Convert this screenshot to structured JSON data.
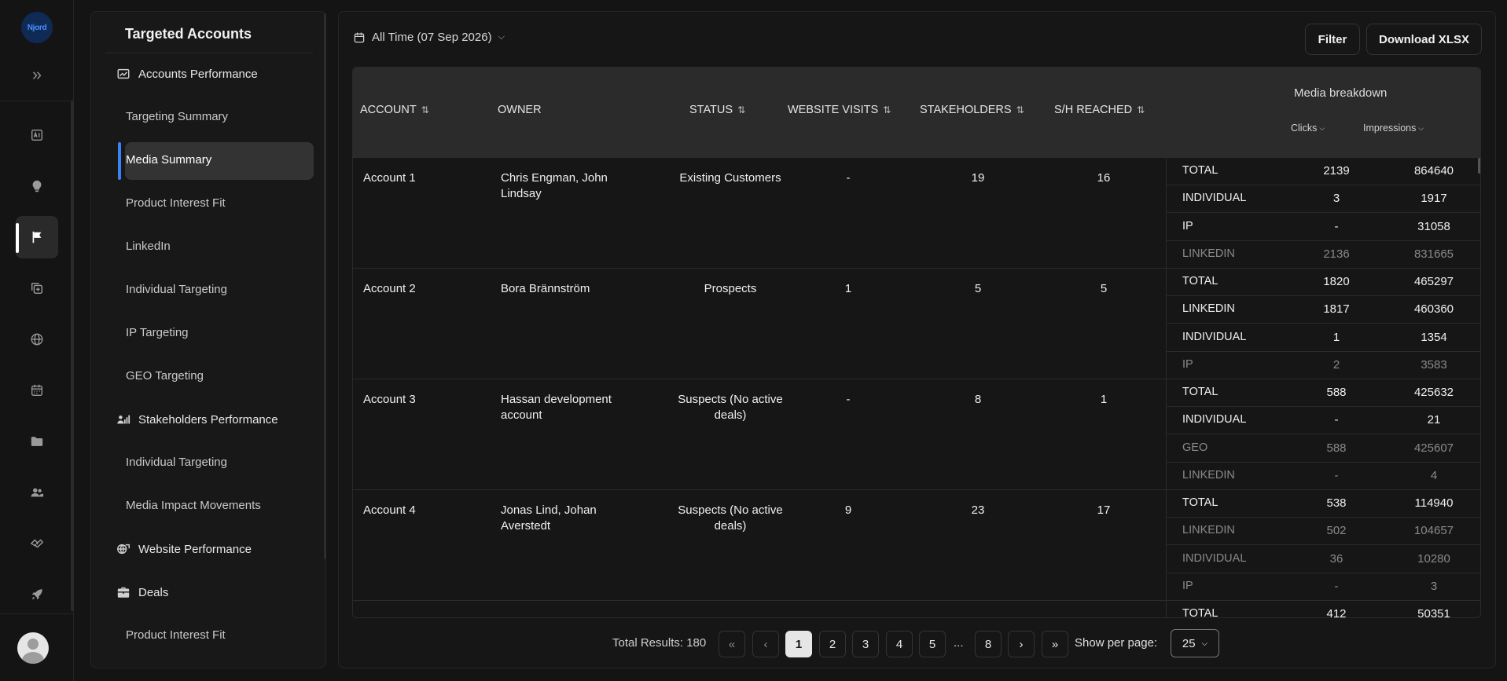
{
  "brand": {
    "logo_text": "Njord"
  },
  "rail": {
    "icons": [
      "ai-document-icon",
      "lightbulb-icon",
      "flag-icon",
      "add-copy-icon",
      "globe-icon",
      "calendar-icon",
      "folder-icon",
      "users-icon",
      "handshake-icon",
      "rocket-icon"
    ],
    "active": "flag-icon"
  },
  "sidebar": {
    "title": "Targeted Accounts",
    "sections": [
      {
        "label": "Accounts Performance",
        "icon": "chart-icon"
      },
      {
        "label": "Stakeholders Performance",
        "icon": "stakeholders-icon"
      },
      {
        "label": "Website Performance",
        "icon": "website-icon"
      },
      {
        "label": "Deals",
        "icon": "briefcase-icon"
      }
    ],
    "items": [
      "Targeting Summary",
      "Media Summary",
      "Product Interest Fit",
      "LinkedIn",
      "Individual Targeting",
      "IP Targeting",
      "GEO Targeting",
      "Individual Targeting",
      "Media Impact Movements",
      "Product Interest Fit"
    ],
    "active_item": "Media Summary"
  },
  "toolbar": {
    "date_range": "All Time (07 Sep 2026)",
    "filter_label": "Filter",
    "download_label": "Download XLSX"
  },
  "table": {
    "headers": {
      "account": "ACCOUNT",
      "owner": "OWNER",
      "status": "STATUS",
      "website_visits": "WEBSITE VISITS",
      "stakeholders": "STAKEHOLDERS",
      "sh_reached": "S/H REACHED",
      "media_breakdown": "Media breakdown",
      "clicks": "Clicks",
      "impressions": "Impressions"
    },
    "rows": [
      {
        "account": "Account 1",
        "owner": "Chris Engman, John Lindsay",
        "status": "Existing Customers",
        "website_visits": "-",
        "stakeholders": "19",
        "sh_reached": "16",
        "breakdown": [
          {
            "label": "TOTAL",
            "clicks": "2139",
            "impressions": "864640",
            "dim": false
          },
          {
            "label": "INDIVIDUAL",
            "clicks": "3",
            "impressions": "1917",
            "dim": false
          },
          {
            "label": "IP",
            "clicks": "-",
            "impressions": "31058",
            "dim": false
          },
          {
            "label": "LINKEDIN",
            "clicks": "2136",
            "impressions": "831665",
            "dim": true
          }
        ]
      },
      {
        "account": "Account 2",
        "owner": "Bora Brännström",
        "status": "Prospects",
        "website_visits": "1",
        "stakeholders": "5",
        "sh_reached": "5",
        "breakdown": [
          {
            "label": "TOTAL",
            "clicks": "1820",
            "impressions": "465297",
            "dim": false
          },
          {
            "label": "LINKEDIN",
            "clicks": "1817",
            "impressions": "460360",
            "dim": false
          },
          {
            "label": "INDIVIDUAL",
            "clicks": "1",
            "impressions": "1354",
            "dim": false
          },
          {
            "label": "IP",
            "clicks": "2",
            "impressions": "3583",
            "dim": true
          }
        ]
      },
      {
        "account": "Account 3",
        "owner": "Hassan development account",
        "status": "Suspects (No active deals)",
        "website_visits": "-",
        "stakeholders": "8",
        "sh_reached": "1",
        "breakdown": [
          {
            "label": "TOTAL",
            "clicks": "588",
            "impressions": "425632",
            "dim": false
          },
          {
            "label": "INDIVIDUAL",
            "clicks": "-",
            "impressions": "21",
            "dim": false
          },
          {
            "label": "GEO",
            "clicks": "588",
            "impressions": "425607",
            "dim": true
          },
          {
            "label": "LINKEDIN",
            "clicks": "-",
            "impressions": "4",
            "dim": true
          }
        ]
      },
      {
        "account": "Account 4",
        "owner": "Jonas Lind, Johan Averstedt",
        "status": "Suspects (No active deals)",
        "website_visits": "9",
        "stakeholders": "23",
        "sh_reached": "17",
        "breakdown": [
          {
            "label": "TOTAL",
            "clicks": "538",
            "impressions": "114940",
            "dim": false
          },
          {
            "label": "LINKEDIN",
            "clicks": "502",
            "impressions": "104657",
            "dim": true
          },
          {
            "label": "INDIVIDUAL",
            "clicks": "36",
            "impressions": "10280",
            "dim": true
          },
          {
            "label": "IP",
            "clicks": "-",
            "impressions": "3",
            "dim": true
          }
        ]
      },
      {
        "account": "",
        "owner": "",
        "status": "",
        "website_visits": "",
        "stakeholders": "",
        "sh_reached": "",
        "breakdown": [
          {
            "label": "TOTAL",
            "clicks": "412",
            "impressions": "50351",
            "dim": false
          }
        ]
      }
    ]
  },
  "pagination": {
    "total_label": "Total Results: 180",
    "pages": [
      "1",
      "2",
      "3",
      "4",
      "5",
      "...",
      "8"
    ],
    "current": "1",
    "per_page_label": "Show per page:",
    "per_page_value": "25"
  }
}
